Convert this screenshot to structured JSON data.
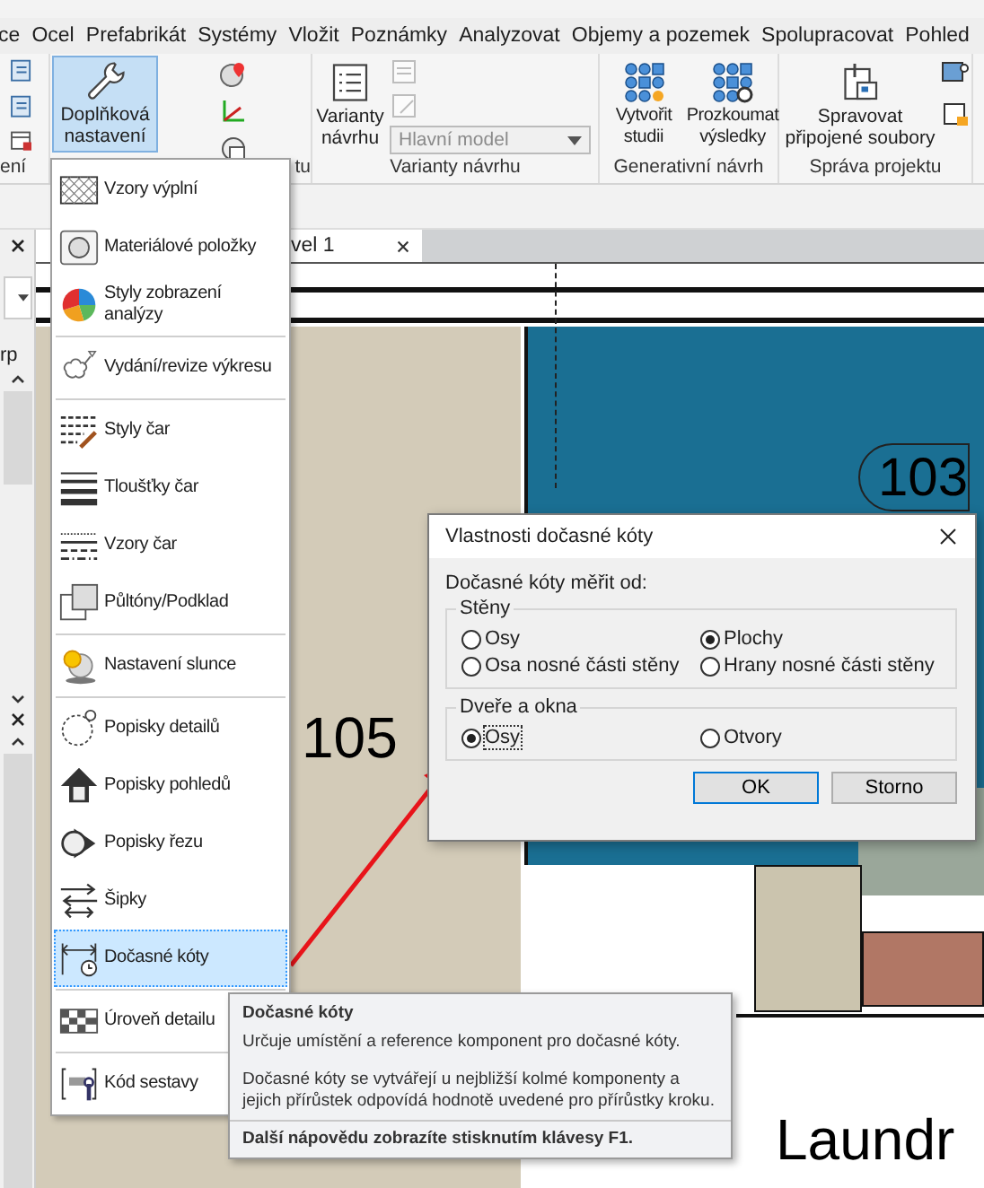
{
  "ribbon_tabs": [
    "ce",
    "Ocel",
    "Prefabrikát",
    "Systémy",
    "Vložit",
    "Poznámky",
    "Analyzovat",
    "Objemy a pozemek",
    "Spolupracovat",
    "Pohled"
  ],
  "ribbon": {
    "left_group_label": "ení",
    "settings_button": {
      "label": "Doplňková nastavení",
      "pressed": true
    },
    "settings_group_label": "tu",
    "design_options": {
      "button": "Varianty návrhu",
      "dropdown": "Hlavní model",
      "group_label": "Varianty návrhu"
    },
    "generative": {
      "buttons": [
        "Vytvořit studii",
        "Prozkoumat výsledky"
      ],
      "group_label": "Generativní návrh"
    },
    "project": {
      "button": "Spravovat připojené soubory",
      "group_label": "Správa projektu"
    }
  },
  "properties_palette": {
    "label": "rp"
  },
  "view_tab": {
    "title": "vel 1"
  },
  "floor_plan": {
    "room_tags": [
      "103",
      "105",
      "Laundr"
    ]
  },
  "menu": {
    "groups": [
      {
        "items": [
          {
            "label": "Vzory výplní",
            "selected": false
          },
          {
            "label": "Materiálové položky",
            "selected": false
          },
          {
            "label": "Styly zobrazení analýzy",
            "selected": false
          }
        ]
      },
      {
        "items": [
          {
            "label": "Vydání/revize výkresu",
            "selected": false
          }
        ]
      },
      {
        "items": [
          {
            "label": "Styly čar",
            "selected": false
          },
          {
            "label": "Tloušťky čar",
            "selected": false
          },
          {
            "label": "Vzory čar",
            "selected": false
          },
          {
            "label": "Půltóny/Podklad",
            "selected": false
          }
        ]
      },
      {
        "items": [
          {
            "label": "Nastavení slunce",
            "selected": false
          }
        ]
      },
      {
        "items": [
          {
            "label": "Popisky detailů",
            "selected": false
          },
          {
            "label": "Popisky pohledů",
            "selected": false
          },
          {
            "label": "Popisky řezu",
            "selected": false
          },
          {
            "label": "Šipky",
            "selected": false
          },
          {
            "label": "Dočasné kóty",
            "selected": true
          }
        ]
      },
      {
        "items": [
          {
            "label": "Úroveň detailu",
            "selected": false
          }
        ]
      },
      {
        "items": [
          {
            "label": "Kód sestavy",
            "selected": false
          }
        ]
      }
    ]
  },
  "dialog": {
    "title": "Vlastnosti dočasné kóty",
    "prompt": "Dočasné kóty měřit od:",
    "groups": [
      {
        "title": "Stěny",
        "options": [
          {
            "label": "Osy",
            "selected": false
          },
          {
            "label": "Plochy",
            "selected": true
          },
          {
            "label": "Osa nosné části stěny",
            "selected": false
          },
          {
            "label": "Hrany nosné části stěny",
            "selected": false
          }
        ]
      },
      {
        "title": "Dveře a okna",
        "options": [
          {
            "label": "Osy",
            "selected": true
          },
          {
            "label": "Otvory",
            "selected": false
          }
        ]
      }
    ],
    "buttons": [
      "OK",
      "Storno"
    ]
  },
  "tooltip": {
    "title": "Dočasné kóty",
    "summary": "Určuje umístění a reference komponent pro dočasné kóty.",
    "details": "Dočasné kóty se vytvářejí u nejbližší kolmé komponenty a jejich přírůstek odpovídá hodnotě uvedené pro přírůstky kroku.",
    "footer": "Další nápovědu zobrazíte stisknutím klávesy F1."
  }
}
